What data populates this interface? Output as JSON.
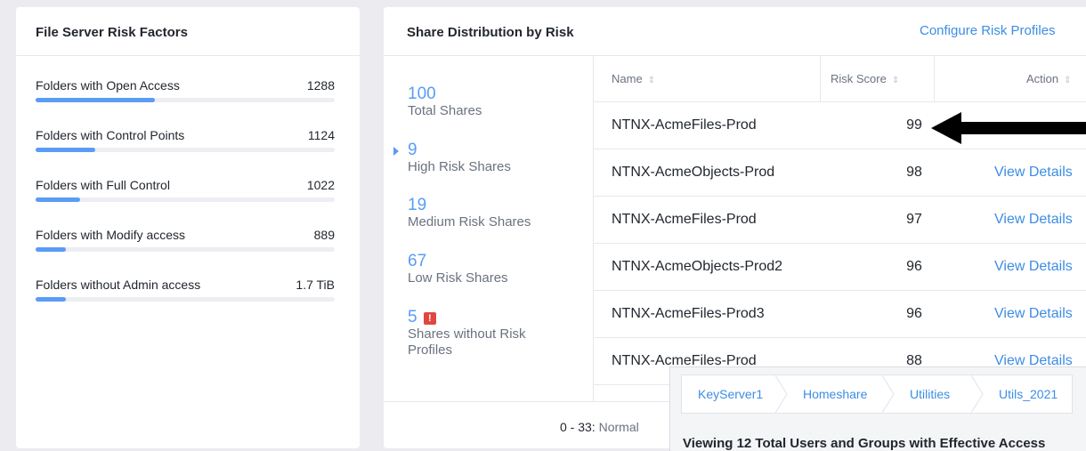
{
  "left_panel": {
    "title": "File Server Risk Factors",
    "factors": [
      {
        "label": "Folders with Open Access",
        "value": "1288",
        "fraction": 0.4
      },
      {
        "label": "Folders with Control Points",
        "value": "1124",
        "fraction": 0.2
      },
      {
        "label": "Folders with Full Control",
        "value": "1022",
        "fraction": 0.15
      },
      {
        "label": "Folders with Modify access",
        "value": "889",
        "fraction": 0.1
      },
      {
        "label": "Folders without Admin access",
        "value": "1.7 TiB",
        "fraction": 0.1
      }
    ]
  },
  "right_panel": {
    "title": "Share Distribution by Risk",
    "configure_link": "Configure Risk Profiles",
    "stats": [
      {
        "num": "100",
        "label": "Total Shares"
      },
      {
        "num": "9",
        "label": "High Risk Shares"
      },
      {
        "num": "19",
        "label": "Medium Risk Shares"
      },
      {
        "num": "67",
        "label": "Low Risk Shares"
      },
      {
        "num": "5",
        "label": "Shares without Risk Profiles",
        "warn": "!"
      }
    ],
    "table": {
      "headers": {
        "name": "Name",
        "risk": "Risk Score",
        "action": "Action"
      },
      "sort_icon": "⇕",
      "rows": [
        {
          "name": "NTNX-AcmeFiles-Prod",
          "score": "99",
          "action": ""
        },
        {
          "name": "NTNX-AcmeObjects-Prod",
          "score": "98",
          "action": "View Details"
        },
        {
          "name": "NTNX-AcmeFiles-Prod",
          "score": "97",
          "action": "View Details"
        },
        {
          "name": "NTNX-AcmeObjects-Prod2",
          "score": "96",
          "action": "View Details"
        },
        {
          "name": "NTNX-AcmeFiles-Prod3",
          "score": "96",
          "action": "View Details"
        },
        {
          "name": "NTNX-AcmeFiles-Prod",
          "score": "88",
          "action": "View Details"
        }
      ]
    },
    "footer": {
      "range": "0 - 33:",
      "range_label": "Normal"
    }
  },
  "popup": {
    "breadcrumbs": [
      "KeyServer1",
      "Homeshare",
      "Utilities",
      "Utils_2021"
    ],
    "headline": "Viewing 12 Total Users and Groups with Effective Access"
  },
  "colors": {
    "accent": "#3c8de5",
    "bar": "#5a9cf5",
    "warn": "#e0473e"
  }
}
